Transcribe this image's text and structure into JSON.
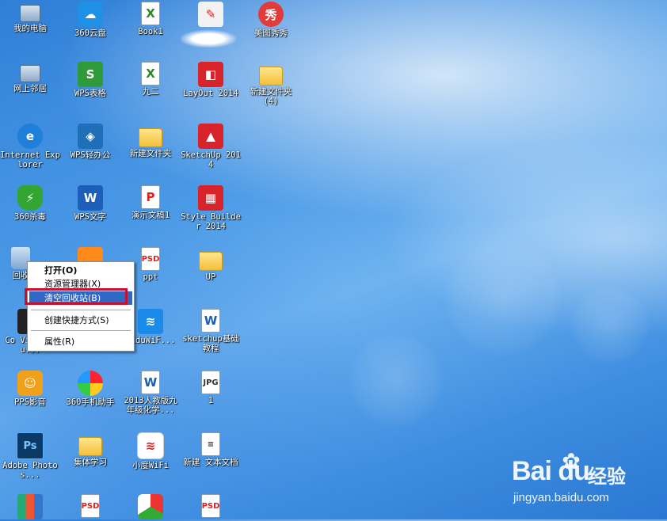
{
  "desktop": {
    "icons": [
      {
        "label": "我的电脑",
        "icon": "computer-icon",
        "glyph": ""
      },
      {
        "label": "360云盘",
        "icon": "cloud-drive-icon",
        "glyph": "☁"
      },
      {
        "label": "Book1",
        "icon": "excel-doc-icon",
        "glyph": "X"
      },
      {
        "label": "",
        "icon": "paint-icon",
        "glyph": "✎"
      },
      {
        "label": "美图秀秀",
        "icon": "meitu-icon",
        "glyph": "秀"
      },
      {
        "label": "网上邻居",
        "icon": "network-icon",
        "glyph": ""
      },
      {
        "label": "WPS表格",
        "icon": "wps-sheet-icon",
        "glyph": "S"
      },
      {
        "label": "九二",
        "icon": "excel-doc-icon",
        "glyph": "X"
      },
      {
        "label": "LayOut 2014",
        "icon": "layout-icon",
        "glyph": "◧"
      },
      {
        "label": "新建文件夹 (4)",
        "icon": "folder-icon",
        "glyph": ""
      },
      {
        "label": "Internet Explorer",
        "icon": "ie-icon",
        "glyph": "e"
      },
      {
        "label": "WPS轻办公",
        "icon": "wps-light-icon",
        "glyph": "◈"
      },
      {
        "label": "新建文件夹",
        "icon": "folder-icon",
        "glyph": ""
      },
      {
        "label": "SketchUp 2014",
        "icon": "sketchup-icon",
        "glyph": "▲"
      },
      {
        "label": "360杀毒",
        "icon": "antivirus-icon",
        "glyph": "⚡"
      },
      {
        "label": "WPS文字",
        "icon": "wps-writer-icon",
        "glyph": "W"
      },
      {
        "label": "演示文稿1",
        "icon": "ppt-doc-icon",
        "glyph": "P"
      },
      {
        "label": "Style Builder 2014",
        "icon": "style-builder-icon",
        "glyph": "▦"
      },
      {
        "label": "回收",
        "icon": "recycle-bin-icon",
        "glyph": "♻"
      },
      {
        "label": "",
        "icon": "app-icon",
        "glyph": ""
      },
      {
        "label": "ppt",
        "icon": "psd-file-icon",
        "glyph": "PSD"
      },
      {
        "label": "UP",
        "icon": "folder-icon",
        "glyph": ""
      },
      {
        "label": "Co VideoStu...",
        "icon": "video-studio-icon",
        "glyph": ""
      },
      {
        "label": "aiduWiF...",
        "icon": "baidu-wifi-icon",
        "glyph": "≋"
      },
      {
        "label": "sketchup基础教程",
        "icon": "word-doc-icon",
        "glyph": "W"
      },
      {
        "label": "PPS影音",
        "icon": "pps-icon",
        "glyph": "☺"
      },
      {
        "label": "360手机助手",
        "icon": "phone-assistant-icon",
        "glyph": ""
      },
      {
        "label": "2013人教版九年级化学...",
        "icon": "word-doc-icon",
        "glyph": "W"
      },
      {
        "label": "1",
        "icon": "jpg-file-icon",
        "glyph": "JPG"
      },
      {
        "label": "Adobe Photos...",
        "icon": "photoshop-icon",
        "glyph": "Ps"
      },
      {
        "label": "集体学习",
        "icon": "folder-icon",
        "glyph": ""
      },
      {
        "label": "小度WiFi",
        "icon": "wifi-icon",
        "glyph": "≋"
      },
      {
        "label": "新建 文本文档",
        "icon": "text-doc-icon",
        "glyph": "≡"
      },
      {
        "label": "",
        "icon": "winrar-icon",
        "glyph": ""
      },
      {
        "label": "",
        "icon": "psd-file-icon",
        "glyph": "PSD"
      },
      {
        "label": "",
        "icon": "umbrella-app-icon",
        "glyph": ""
      },
      {
        "label": "",
        "icon": "psd-file-icon",
        "glyph": "PSD"
      }
    ]
  },
  "context_menu": {
    "items": [
      {
        "label": "打开(O)",
        "bold": true
      },
      {
        "label": "资源管理器(X)"
      },
      {
        "label": "清空回收站(B)",
        "highlighted": true
      },
      {
        "label": "创建快捷方式(S)"
      },
      {
        "label": "属性(R)"
      }
    ]
  },
  "watermark": {
    "brand": "Bai du",
    "cn": "经验",
    "url": "jingyan.baidu.com"
  },
  "colors": {
    "menu_highlight": "#3168c5",
    "annotation_box": "#c8102e"
  }
}
